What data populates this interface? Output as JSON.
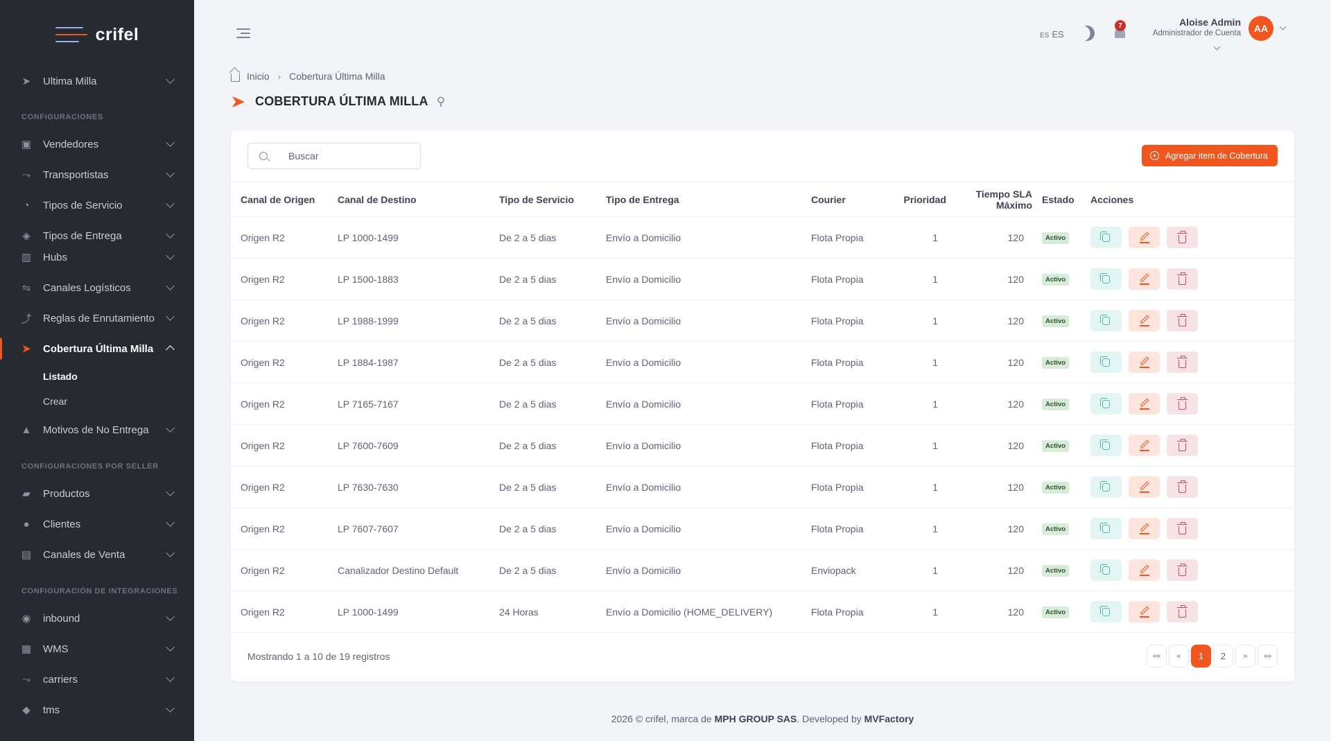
{
  "brand": {
    "name": "crifel"
  },
  "sidebar": {
    "top_item": {
      "label": "Ultima Milla"
    },
    "sections": [
      {
        "title": "CONFIGURACIONES"
      },
      {
        "title": "CONFIGURACIONES POR SELLER"
      },
      {
        "title": "CONFIGURACIÓN DE INTEGRACIONES"
      }
    ],
    "items": [
      {
        "label": "Vendedores",
        "icon": "store-icon"
      },
      {
        "label": "Transportistas",
        "icon": "route-icon"
      },
      {
        "label": "Tipos de Servicio",
        "icon": "clock-icon"
      },
      {
        "label": "Tipos de Entrega",
        "icon": "box-icon"
      },
      {
        "label": "Hubs",
        "icon": "building-icon"
      },
      {
        "label": "Canales Logísticos",
        "icon": "arrows-icon"
      },
      {
        "label": "Reglas de Enrutamiento",
        "icon": "route-rules-icon"
      },
      {
        "label": "Cobertura Última Milla",
        "icon": "send-icon"
      },
      {
        "label": "Motivos de No Entrega",
        "icon": "warning-icon"
      },
      {
        "label": "Productos",
        "icon": "shirt-icon"
      },
      {
        "label": "Clientes",
        "icon": "users-icon"
      },
      {
        "label": "Canales de Venta",
        "icon": "cart-icon"
      },
      {
        "label": "inbound",
        "icon": "inbound-icon"
      },
      {
        "label": "WMS",
        "icon": "warehouse-icon"
      },
      {
        "label": "carriers",
        "icon": "carrier-icon"
      },
      {
        "label": "tms",
        "icon": "tms-icon"
      }
    ],
    "sub_items": [
      {
        "label": "Listado"
      },
      {
        "label": "Crear"
      }
    ]
  },
  "header": {
    "lang_small": "ES",
    "lang": "ES",
    "notifications": "7",
    "user_name": "Aloise Admin",
    "user_role": "Administrador de Cuenta",
    "avatar_initials": "AA"
  },
  "breadcrumb": {
    "home": "Inicio",
    "current": "Cobertura Última Milla"
  },
  "page": {
    "title": "COBERTURA ÚLTIMA MILLA"
  },
  "toolbar": {
    "search_placeholder": "Buscar",
    "add_label": "Agregar item de Cobertura"
  },
  "table": {
    "columns": [
      "Canal de Origen",
      "Canal de Destino",
      "Tipo de Servicio",
      "Tipo de Entrega",
      "Courier",
      "Prioridad",
      "Tiempo SLA Máximo",
      "Estado",
      "Acciones"
    ],
    "rows": [
      {
        "origen": "Origen R2",
        "destino": "LP 1000-1499",
        "servicio": "De 2 a 5 dias",
        "entrega": "Envío a Domicilio",
        "courier": "Flota Propia",
        "prioridad": "1",
        "sla": "120",
        "estado": "Activo"
      },
      {
        "origen": "Origen R2",
        "destino": "LP 1500-1883",
        "servicio": "De 2 a 5 dias",
        "entrega": "Envío a Domicilio",
        "courier": "Flota Propia",
        "prioridad": "1",
        "sla": "120",
        "estado": "Activo"
      },
      {
        "origen": "Origen R2",
        "destino": "LP 1988-1999",
        "servicio": "De 2 a 5 dias",
        "entrega": "Envío a Domicilio",
        "courier": "Flota Propia",
        "prioridad": "1",
        "sla": "120",
        "estado": "Activo"
      },
      {
        "origen": "Origen R2",
        "destino": "LP 1884-1987",
        "servicio": "De 2 a 5 dias",
        "entrega": "Envío a Domicilio",
        "courier": "Flota Propia",
        "prioridad": "1",
        "sla": "120",
        "estado": "Activo"
      },
      {
        "origen": "Origen R2",
        "destino": "LP 7165-7167",
        "servicio": "De 2 a 5 dias",
        "entrega": "Envío a Domicilio",
        "courier": "Flota Propia",
        "prioridad": "1",
        "sla": "120",
        "estado": "Activo"
      },
      {
        "origen": "Origen R2",
        "destino": "LP 7600-7609",
        "servicio": "De 2 a 5 dias",
        "entrega": "Envío a Domicilio",
        "courier": "Flota Propia",
        "prioridad": "1",
        "sla": "120",
        "estado": "Activo"
      },
      {
        "origen": "Origen R2",
        "destino": "LP 7630-7630",
        "servicio": "De 2 a 5 dias",
        "entrega": "Envío a Domicilio",
        "courier": "Flota Propia",
        "prioridad": "1",
        "sla": "120",
        "estado": "Activo"
      },
      {
        "origen": "Origen R2",
        "destino": "LP 7607-7607",
        "servicio": "De 2 a 5 dias",
        "entrega": "Envío a Domicilio",
        "courier": "Flota Propia",
        "prioridad": "1",
        "sla": "120",
        "estado": "Activo"
      },
      {
        "origen": "Origen R2",
        "destino": "Canalizador Destino Default",
        "servicio": "De 2 a 5 dias",
        "entrega": "Envío a Domicilio",
        "courier": "Enviopack",
        "prioridad": "1",
        "sla": "120",
        "estado": "Activo"
      },
      {
        "origen": "Origen R2",
        "destino": "LP 1000-1499",
        "servicio": "24 Horas",
        "entrega": "Envío a Domicilio (HOME_DELIVERY)",
        "courier": "Flota Propia",
        "prioridad": "1",
        "sla": "120",
        "estado": "Activo"
      }
    ]
  },
  "pagination": {
    "showing": "Mostrando 1 a 10 de 19 registros",
    "first": "««",
    "prev": "«",
    "pages": [
      "1",
      "2"
    ],
    "next": "»",
    "last": "»»"
  },
  "footer": {
    "prefix": "2026 © crifel, marca de ",
    "company": "MPH GROUP SAS",
    "middle": ". Developed by ",
    "developer": "MVFactory"
  },
  "colors": {
    "accent": "#f0561e",
    "sidebar_bg": "#272a31",
    "badge_bg": "#d6ecd6"
  }
}
